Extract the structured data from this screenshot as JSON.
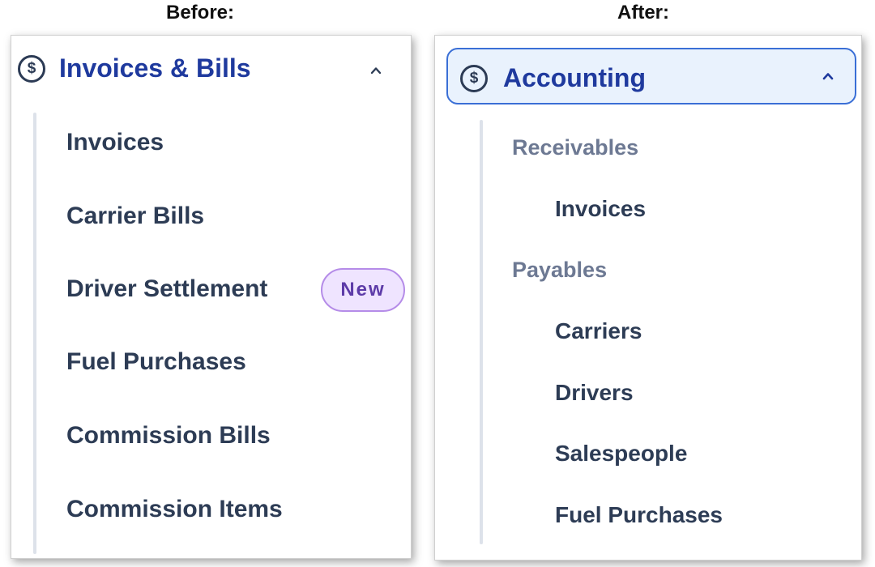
{
  "labels": {
    "before": "Before:",
    "after": "After:"
  },
  "before": {
    "header": {
      "title": "Invoices & Bills",
      "icon": "dollar-circle-icon",
      "icon_glyph": "$",
      "expanded": true
    },
    "items": [
      {
        "label": "Invoices"
      },
      {
        "label": "Carrier Bills"
      },
      {
        "label": "Driver Settlement",
        "badge": "New"
      },
      {
        "label": "Fuel Purchases"
      },
      {
        "label": "Commission Bills"
      },
      {
        "label": "Commission Items"
      }
    ]
  },
  "after": {
    "header": {
      "title": "Accounting",
      "icon": "dollar-circle-icon",
      "icon_glyph": "$",
      "expanded": true
    },
    "sections": [
      {
        "label": "Receivables",
        "items": [
          {
            "label": "Invoices"
          }
        ]
      },
      {
        "label": "Payables",
        "items": [
          {
            "label": "Carriers"
          },
          {
            "label": "Drivers"
          },
          {
            "label": "Salespeople"
          },
          {
            "label": "Fuel Purchases"
          }
        ]
      }
    ]
  },
  "colors": {
    "header_text": "#1f3a9e",
    "item_text": "#2d3c55",
    "section_text": "#6d7993",
    "badge_bg": "#efe4ff",
    "badge_border": "#b58ce8",
    "selected_bg": "#e9f2fd",
    "selected_border": "#3a6fd6"
  }
}
